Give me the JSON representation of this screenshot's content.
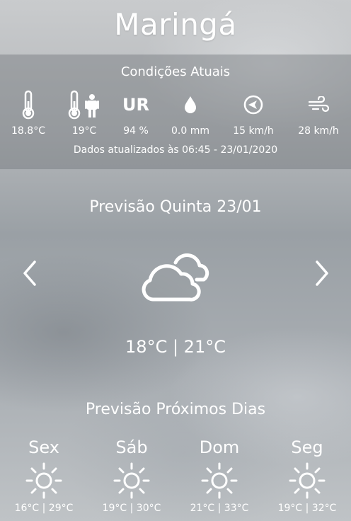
{
  "city": "Maringá",
  "current": {
    "title": "Condições Atuais",
    "metrics": [
      {
        "icon": "thermometer-icon",
        "value": "18.8°C"
      },
      {
        "icon": "feels-like-icon",
        "value": "19°C"
      },
      {
        "icon": "humidity-icon",
        "label": "UR",
        "value": "94 %"
      },
      {
        "icon": "rain-drop-icon",
        "value": "0.0 mm"
      },
      {
        "icon": "wind-direction-icon",
        "value": "15 km/h"
      },
      {
        "icon": "wind-gust-icon",
        "value": "28 km/h"
      }
    ],
    "updated": "Dados atualizados às 06:45 - 23/01/2020"
  },
  "forecast": {
    "title": "Previsão Quinta 23/01",
    "icon": "cloudy-icon",
    "temps": "18°C | 21°C"
  },
  "next_days": {
    "title": "Previsão Próximos Dias",
    "days": [
      {
        "name": "Sex",
        "icon": "sun-icon",
        "temps": "16°C | 29°C"
      },
      {
        "name": "Sáb",
        "icon": "sun-icon",
        "temps": "19°C | 30°C"
      },
      {
        "name": "Dom",
        "icon": "sun-icon",
        "temps": "21°C | 33°C"
      },
      {
        "name": "Seg",
        "icon": "sun-icon",
        "temps": "19°C | 32°C"
      }
    ]
  },
  "colors": {
    "text": "#ffffff",
    "panel": "#6e7276"
  }
}
